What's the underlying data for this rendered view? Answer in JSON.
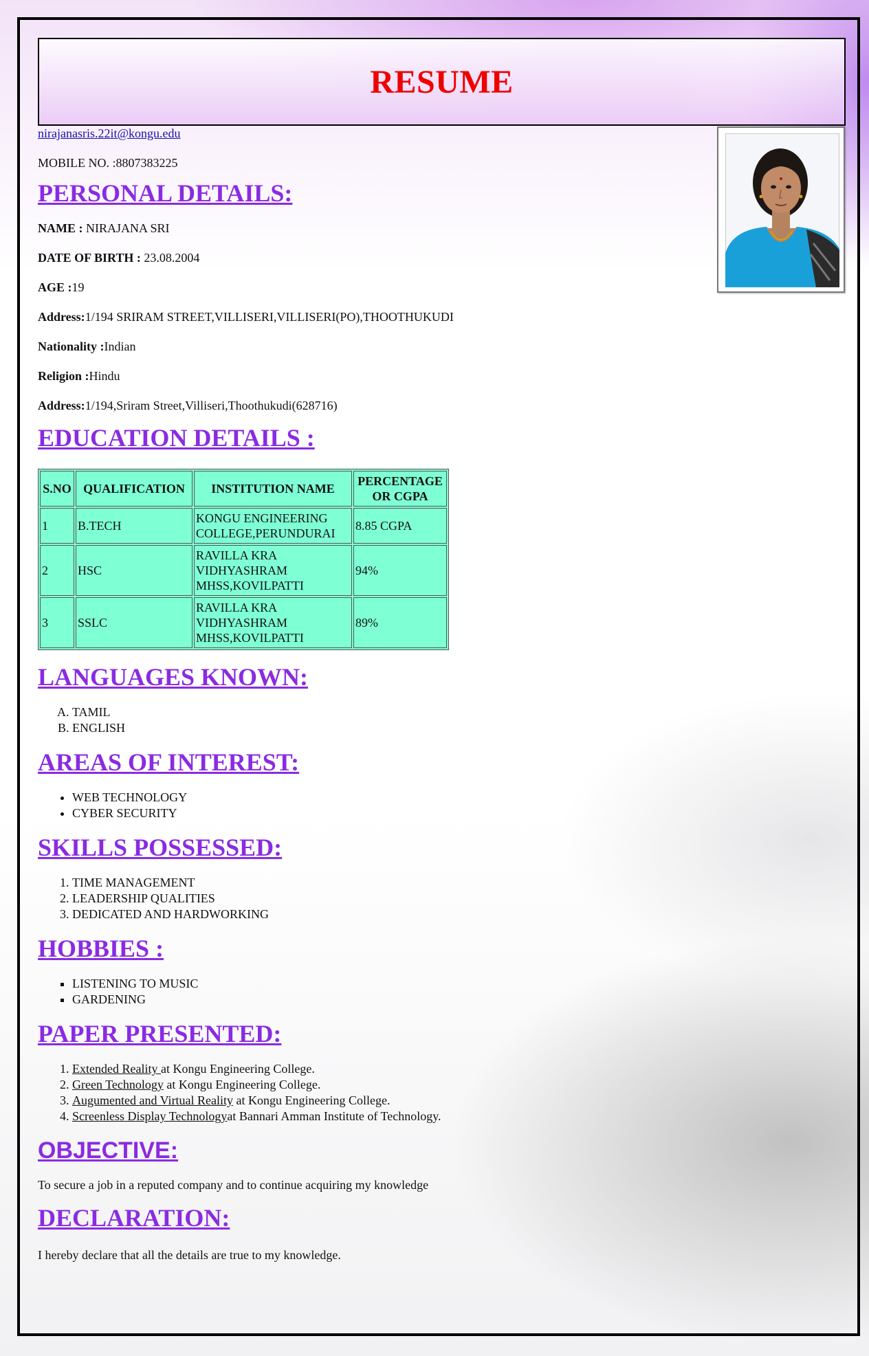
{
  "title": "RESUME",
  "contact": {
    "email": "nirajanasris.22it@kongu.edu",
    "mobile": "MOBILE NO. :8807383225"
  },
  "personal": {
    "heading": "PERSONAL DETAILS:",
    "fields": [
      {
        "label": "NAME : ",
        "value": "NIRAJANA SRI"
      },
      {
        "label": "DATE OF BIRTH : ",
        "value": "23.08.2004"
      },
      {
        "label": "AGE :",
        "value": "19"
      },
      {
        "label": "Address:",
        "value": "1/194 SRIRAM STREET,VILLISERI,VILLISERI(PO),THOOTHUKUDI"
      },
      {
        "label": "Nationality :",
        "value": "Indian"
      },
      {
        "label": "Religion :",
        "value": "Hindu"
      },
      {
        "label": "Address:",
        "value": "1/194,Sriram Street,Villiseri,Thoothukudi(628716)"
      }
    ]
  },
  "education": {
    "heading": "EDUCATION DETAILS :",
    "headers": [
      "S.NO",
      "QUALIFICATION",
      "INSTITUTION NAME",
      "PERCENTAGE OR CGPA"
    ],
    "rows": [
      [
        "1",
        "B.TECH",
        "KONGU ENGINEERING COLLEGE,PERUNDURAI",
        "8.85 CGPA"
      ],
      [
        "2",
        "HSC",
        "RAVILLA KRA VIDHYASHRAM MHSS,KOVILPATTI",
        "94%"
      ],
      [
        "3",
        "SSLC",
        "RAVILLA KRA VIDHYASHRAM MHSS,KOVILPATTI",
        "89%"
      ]
    ]
  },
  "languages": {
    "heading": "LANGUAGES KNOWN:",
    "items": [
      "TAMIL",
      "ENGLISH"
    ]
  },
  "interests": {
    "heading": "AREAS OF INTEREST:",
    "items": [
      "WEB TECHNOLOGY",
      "CYBER SECURITY"
    ]
  },
  "skills": {
    "heading": "SKILLS POSSESSED:",
    "items": [
      "TIME MANAGEMENT",
      "LEADERSHIP QUALITIES",
      "DEDICATED AND HARDWORKING"
    ]
  },
  "hobbies": {
    "heading": "HOBBIES :",
    "items": [
      "LISTENING TO MUSIC",
      "GARDENING"
    ]
  },
  "papers": {
    "heading": "PAPER PRESENTED:",
    "items": [
      {
        "topic": "Extended Reality ",
        "venue": "at Kongu Engineering College."
      },
      {
        "topic": "Green Technology",
        "venue": " at Kongu Engineering College."
      },
      {
        "topic": "Augumented and Virtual Reality",
        "venue": " at Kongu Engineering College."
      },
      {
        "topic": "Screenless Display Technology",
        "venue": "at Bannari Amman Institute of Technology."
      }
    ]
  },
  "objective": {
    "heading": "OBJECTIVE:",
    "text": "To secure a job in a reputed company and to continue acquiring my knowledge"
  },
  "declaration": {
    "heading": "DECLARATION:",
    "text": "I hereby declare that all the details are true to my knowledge."
  },
  "colors": {
    "title": "#ee0000",
    "heading": "#8a2be2",
    "table_bg": "#7fffd4",
    "link": "#1a0dab"
  }
}
